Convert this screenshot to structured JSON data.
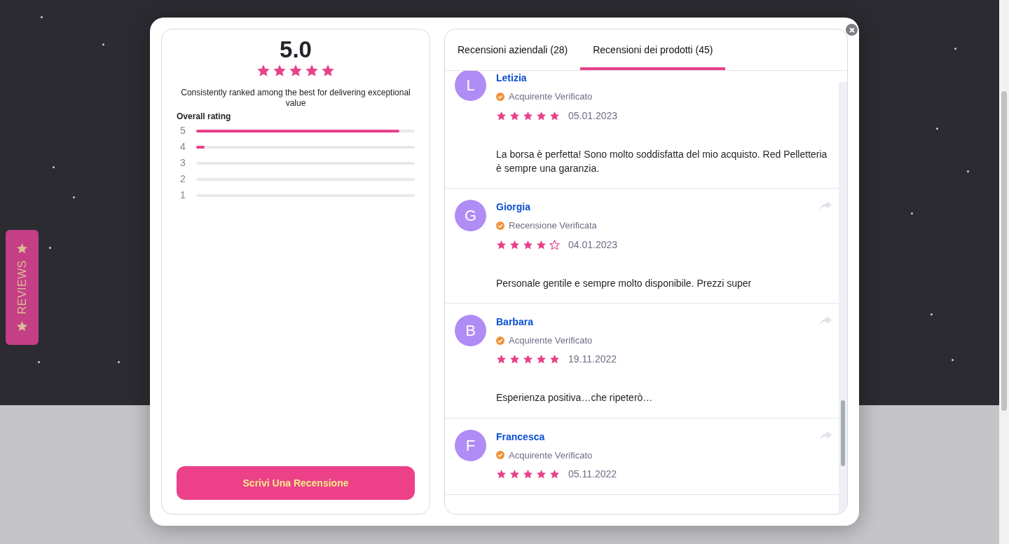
{
  "side_tab": {
    "label": "REVIEWS"
  },
  "summary": {
    "score": "5.0",
    "stars": 5,
    "tagline": "Consistently ranked among the best for delivering exceptional value",
    "breakdown_title": "Overall rating",
    "breakdown": [
      {
        "label": "5",
        "level": 0.93
      },
      {
        "label": "4",
        "level": 0.04
      },
      {
        "label": "3"
      },
      {
        "label": "2"
      },
      {
        "label": "1"
      }
    ],
    "write_button": "Scrivi Una Recensione"
  },
  "tabs": [
    {
      "label": "Recensioni aziendali (28)",
      "selected": false
    },
    {
      "label": "Recensioni dei prodotti (45)",
      "selected": true
    }
  ],
  "reviews": [
    {
      "initial": "L",
      "name": "Letizia",
      "badge": "Acquirente Verificato",
      "stars": 5,
      "date": "05.01.2023",
      "text": "La borsa è perfetta! Sono molto soddisfatta del mio acquisto. Red Pelletteria è sempre una garanzia."
    },
    {
      "initial": "G",
      "name": "Giorgia",
      "badge": "Recensione Verificata",
      "stars": 4,
      "date": "04.01.2023",
      "text": "Personale gentile e sempre molto disponibile. Prezzi super"
    },
    {
      "initial": "B",
      "name": "Barbara",
      "badge": "Acquirente Verificato",
      "stars": 5,
      "date": "19.11.2022",
      "text": "Esperienza positiva…che ripeterò…"
    },
    {
      "initial": "F",
      "name": "Francesca",
      "badge": "Acquirente Verificato",
      "stars": 5,
      "date": "05.11.2022"
    }
  ]
}
